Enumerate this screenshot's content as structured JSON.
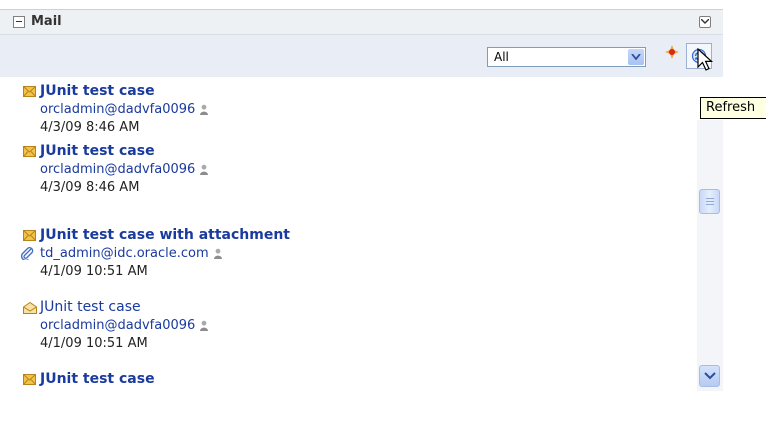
{
  "portlet": {
    "title": "Mail",
    "filter_value": "All",
    "tooltip": "Refresh"
  },
  "messages": [
    {
      "subject": "JUnit test case",
      "sender": "orcladmin@dadvfa0096",
      "date": "4/3/09 8:46 AM",
      "unread": true,
      "attachment": false
    },
    {
      "subject": "JUnit test case",
      "sender": "orcladmin@dadvfa0096",
      "date": "4/3/09 8:46 AM",
      "unread": true,
      "attachment": false
    },
    {
      "subject": "JUnit test case with attachment",
      "sender": "td_admin@idc.oracle.com",
      "date": "4/1/09 10:51 AM",
      "unread": true,
      "attachment": true
    },
    {
      "subject": "JUnit test case",
      "sender": "orcladmin@dadvfa0096",
      "date": "4/1/09 10:51 AM",
      "unread": false,
      "attachment": false
    },
    {
      "subject": "JUnit test case",
      "sender": "",
      "date": "",
      "unread": true,
      "attachment": false
    }
  ],
  "icons": {
    "collapse": "collapse-icon",
    "menu": "chevron-down-icon",
    "add": "add-icon",
    "refresh": "refresh-icon",
    "unread_mail": "envelope-closed-icon",
    "read_mail": "envelope-open-icon",
    "attachment": "paperclip-icon",
    "presence": "presence-icon"
  },
  "colors": {
    "link": "#1a3a9e",
    "header_bg": "#eef1f4",
    "toolbar_bg": "#e9eef6",
    "tooltip_bg": "#ffffe1"
  }
}
